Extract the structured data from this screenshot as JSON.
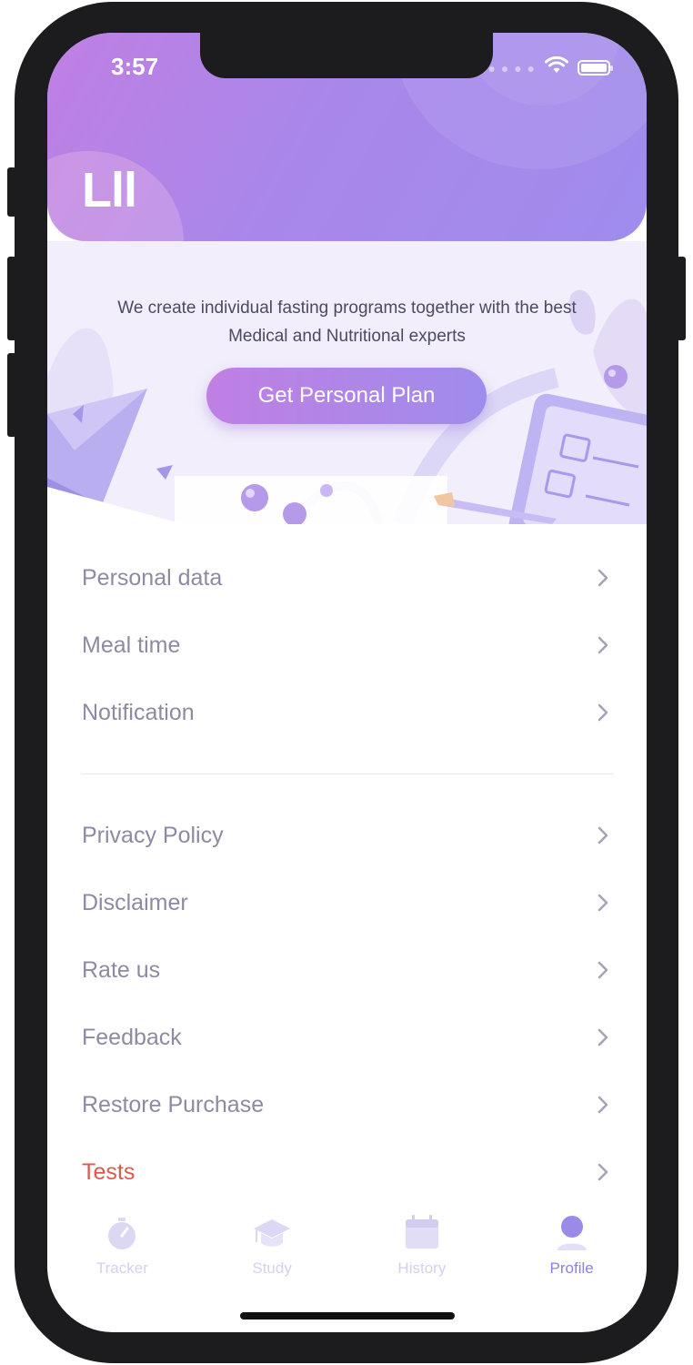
{
  "status_bar": {
    "time": "3:57",
    "signal_icon": "cellular-signal-icon",
    "wifi_icon": "wifi-icon",
    "battery_icon": "battery-icon"
  },
  "header": {
    "user_name": "Lll"
  },
  "banner": {
    "text_line1": "We create individual fasting programs together with the best",
    "text_line2": "Medical and Nutritional experts",
    "button_label": "Get Personal Plan"
  },
  "menu": {
    "group1": [
      {
        "label": "Personal data"
      },
      {
        "label": "Meal time"
      },
      {
        "label": "Notification"
      }
    ],
    "group2": [
      {
        "label": "Privacy Policy"
      },
      {
        "label": "Disclaimer"
      },
      {
        "label": "Rate us"
      },
      {
        "label": "Feedback"
      },
      {
        "label": "Restore Purchase"
      },
      {
        "label": "Tests"
      }
    ]
  },
  "tabs": [
    {
      "label": "Tracker",
      "icon": "stopwatch-icon",
      "active": false
    },
    {
      "label": "Study",
      "icon": "graduation-cap-icon",
      "active": false
    },
    {
      "label": "History",
      "icon": "calendar-icon",
      "active": false
    },
    {
      "label": "Profile",
      "icon": "user-icon",
      "active": true
    }
  ],
  "colors": {
    "accent": "#8f7ee6",
    "gradient_start": "#c07fe3",
    "gradient_end": "#9f8cec",
    "menu_text": "#8e8aa1",
    "danger_text": "#e2574c",
    "inactive_tab": "#d5d0ef"
  }
}
